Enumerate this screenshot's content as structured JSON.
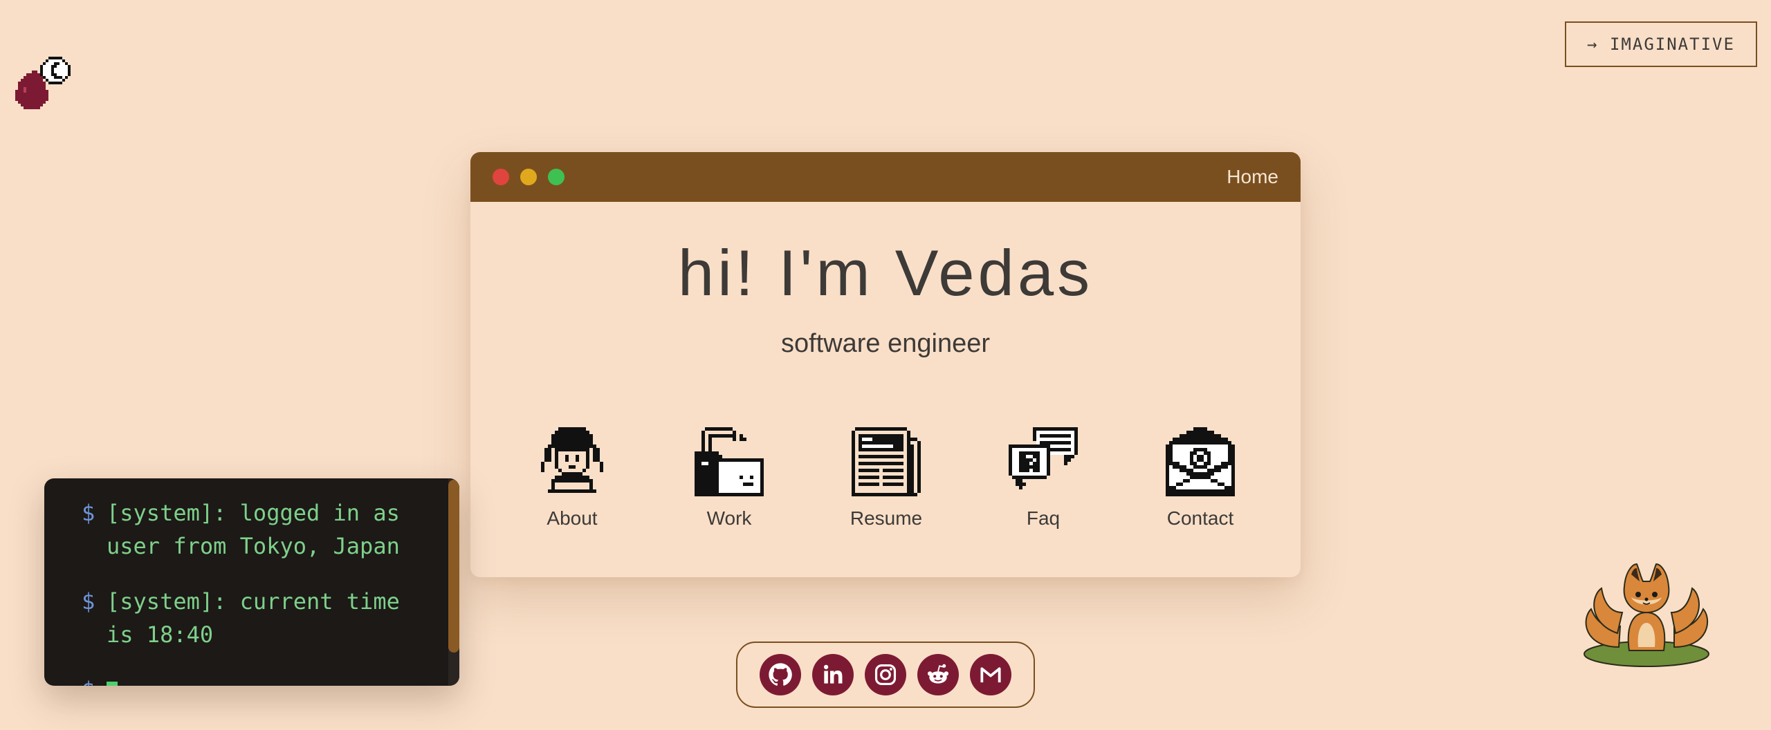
{
  "top_right_button": {
    "arrow": "→",
    "label": "IMAGINATIVE"
  },
  "window": {
    "title": "Home",
    "hero_title": "hi! I'm Vedas",
    "hero_subtitle": "software engineer",
    "apps": [
      {
        "label": "About",
        "icon": "person-icon"
      },
      {
        "label": "Work",
        "icon": "folder-icon"
      },
      {
        "label": "Resume",
        "icon": "newspaper-icon"
      },
      {
        "label": "Faq",
        "icon": "speech-bubbles-icon"
      },
      {
        "label": "Contact",
        "icon": "envelope-icon"
      }
    ]
  },
  "terminal": {
    "lines": [
      {
        "prompt": "$",
        "text": "[system]: logged in as user from Tokyo, Japan"
      },
      {
        "prompt": "$",
        "text": "[system]: current time is 18:40"
      },
      {
        "prompt": "$",
        "text": ""
      }
    ]
  },
  "social": [
    {
      "name": "GitHub",
      "icon": "github-icon"
    },
    {
      "name": "LinkedIn",
      "icon": "linkedin-icon"
    },
    {
      "name": "Instagram",
      "icon": "instagram-icon"
    },
    {
      "name": "Reddit",
      "icon": "reddit-icon"
    },
    {
      "name": "Gmail",
      "icon": "gmail-icon"
    }
  ],
  "colors": {
    "background": "#f9dfc8",
    "titlebar": "#7a4f1f",
    "accent": "#7d1a33",
    "terminal_bg": "#1c1917",
    "terminal_text": "#7ed08a",
    "terminal_prompt": "#6f94d8"
  }
}
